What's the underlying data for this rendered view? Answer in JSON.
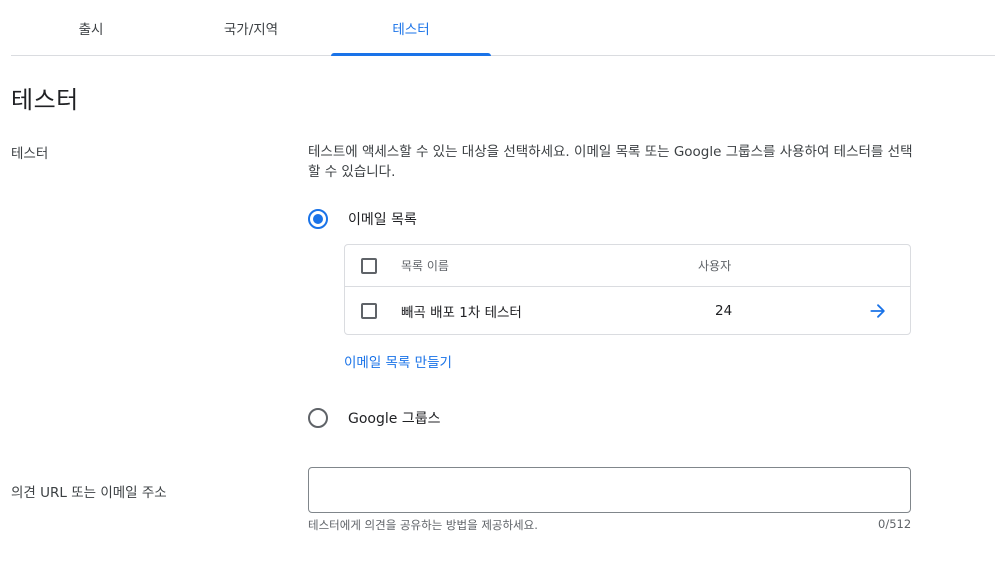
{
  "tabs": [
    {
      "label": "출시",
      "active": false
    },
    {
      "label": "국가/지역",
      "active": false
    },
    {
      "label": "테스터",
      "active": true
    }
  ],
  "page_title": "테스터",
  "testers": {
    "label": "테스터",
    "description": "테스트에 액세스할 수 있는 대상을 선택하세요. 이메일 목록 또는 Google 그룹스를 사용하여 테스터를 선택할 수 있습니다.",
    "option_email_list": {
      "label": "이메일 목록",
      "selected": true
    },
    "list_table": {
      "header_name": "목록 이름",
      "header_users": "사용자",
      "rows": [
        {
          "name": "빼곡 배포 1차 테스터",
          "users": "24"
        }
      ]
    },
    "create_list_link": "이메일 목록 만들기",
    "option_google_groups": {
      "label": "Google 그룹스",
      "selected": false
    }
  },
  "feedback": {
    "label": "의견 URL 또는 이메일 주소",
    "value": "",
    "placeholder": "",
    "helper_text": "테스터에게 의견을 공유하는 방법을 제공하세요.",
    "char_count": "0/512"
  },
  "colors": {
    "accent": "#1a73e8",
    "text": "#202124",
    "border": "#dadce0"
  },
  "icons": {
    "row_action": "arrow-right-icon"
  }
}
